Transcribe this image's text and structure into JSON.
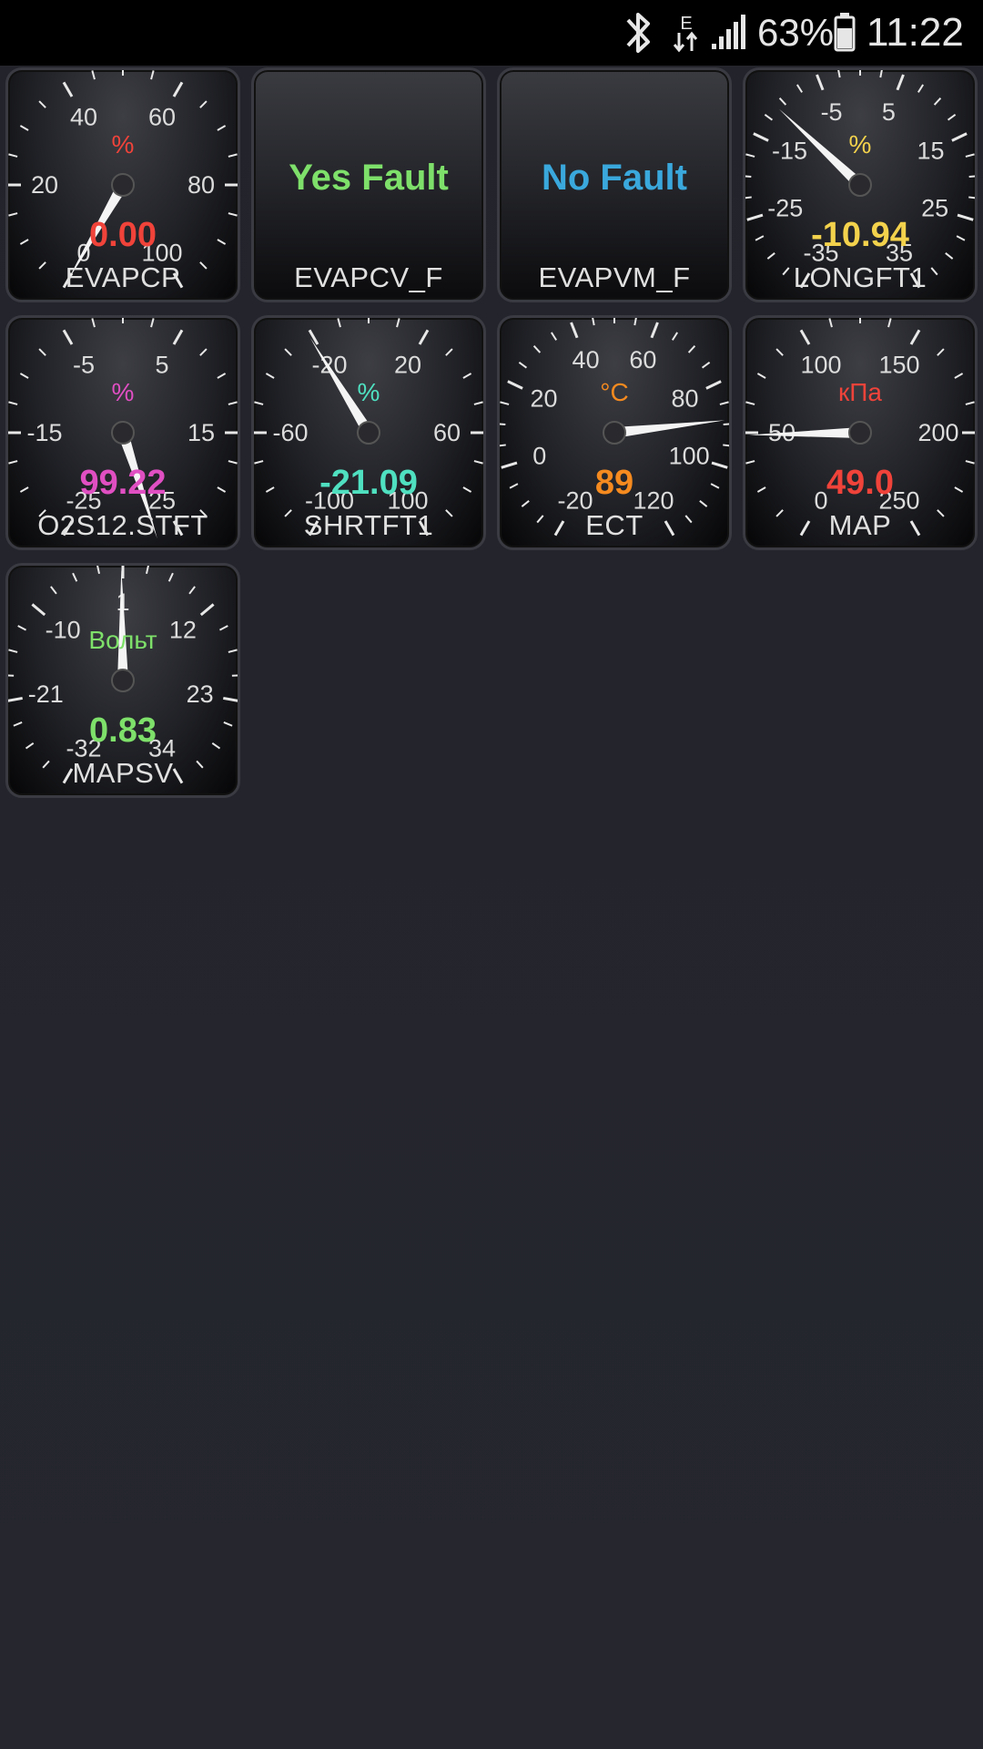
{
  "status_bar": {
    "icons": [
      "bluetooth-icon",
      "data-transfer-icon",
      "signal-icon",
      "battery-icon"
    ],
    "battery_percent": "63%",
    "time": "11:22"
  },
  "gauges": [
    {
      "id": "evapcp",
      "type": "dial",
      "label": "EVAPCP",
      "value": "0.00",
      "value_num": 0.0,
      "unit": "%",
      "color": "#f0433a",
      "min": 0,
      "max": 100,
      "ticks": [
        "0",
        "20",
        "40",
        "60",
        "80",
        "100"
      ]
    },
    {
      "id": "evapcv_f",
      "type": "text",
      "label": "EVAPCV_F",
      "text": "Yes Fault",
      "color": "#7ee06a"
    },
    {
      "id": "evapvm_f",
      "type": "text",
      "label": "EVAPVM_F",
      "text": "No Fault",
      "color": "#3aa8dc"
    },
    {
      "id": "longft1",
      "type": "dial",
      "label": "LONGFT1",
      "value": "-10.94",
      "value_num": -10.94,
      "unit": "%",
      "color": "#f3d24c",
      "min": -35,
      "max": 35,
      "ticks": [
        "-35",
        "-25",
        "-15",
        "-5",
        "5",
        "15",
        "25",
        "35"
      ]
    },
    {
      "id": "o2s12_stft",
      "type": "dial",
      "label": "O2S12.STFT",
      "value": "99.22",
      "value_num": 99.22,
      "unit": "%",
      "color": "#e04fc2",
      "min": -25,
      "max": 25,
      "ticks": [
        "-25",
        "-15",
        "-5",
        "5",
        "15",
        "25"
      ]
    },
    {
      "id": "shrtft1",
      "type": "dial",
      "label": "SHRTFT1",
      "value": "-21.09",
      "value_num": -21.09,
      "unit": "%",
      "color": "#4fe0c0",
      "min": -100,
      "max": 100,
      "ticks": [
        "-100",
        "-60",
        "-20",
        "20",
        "60",
        "100"
      ]
    },
    {
      "id": "ect",
      "type": "dial",
      "label": "ECT",
      "value": "89",
      "value_num": 89,
      "unit": "°C",
      "color": "#f58a1f",
      "min": -20,
      "max": 120,
      "ticks": [
        "-20",
        "0",
        "20",
        "40",
        "60",
        "80",
        "100",
        "120"
      ]
    },
    {
      "id": "map",
      "type": "dial",
      "label": "MAP",
      "value": "49.0",
      "value_num": 49.0,
      "unit": "кПа",
      "color": "#f0433a",
      "min": 0,
      "max": 250,
      "ticks": [
        "0",
        "50",
        "100",
        "150",
        "200",
        "250"
      ]
    },
    {
      "id": "mapsv",
      "type": "dial",
      "label": "MAPSV",
      "value": "0.83",
      "value_num": 0.83,
      "unit": "Вольт",
      "color": "#7ee06a",
      "min": -32,
      "max": 34,
      "ticks": [
        "-32",
        "-21",
        "-10",
        "1",
        "12",
        "23",
        "34"
      ]
    }
  ]
}
